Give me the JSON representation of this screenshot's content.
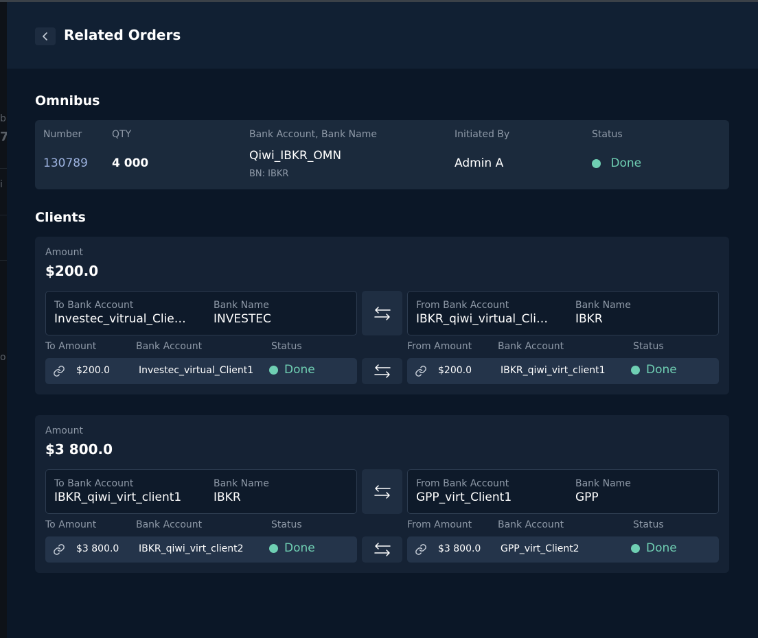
{
  "header": {
    "title": "Related Orders"
  },
  "backdrop": {
    "frag1": "b",
    "frag2": "7",
    "frag3": "i",
    "frag4": "o"
  },
  "omnibus": {
    "title": "Omnibus",
    "headers": {
      "number": "Number",
      "qty": "QTY",
      "bank": "Bank Account, Bank Name",
      "initiated": "Initiated By",
      "status": "Status"
    },
    "number": "130789",
    "qty": "4 000",
    "bank_account": "Qiwi_IBKR_OMN",
    "bank_name": "BN: IBKR",
    "initiated_by": "Admin A",
    "status": "Done"
  },
  "clients": {
    "title": "Clients",
    "labels": {
      "amount": "Amount",
      "to_bank_account": "To Bank Account",
      "bank_name": "Bank Name",
      "from_bank_account": "From Bank Account",
      "to_amount": "To Amount",
      "from_amount": "From Amount",
      "bank_account": "Bank Account",
      "status": "Status"
    },
    "items": [
      {
        "amount": "$200.0",
        "to_account": "Investec_vitrual_Clie…",
        "to_bank": "INVESTEC",
        "from_account": "IBKR_qiwi_virtual_Cli…",
        "from_bank": "IBKR",
        "to_row": {
          "amount": "$200.0",
          "account": "Investec_virtual_Client1",
          "status": "Done"
        },
        "from_row": {
          "amount": "$200.0",
          "account": "IBKR_qiwi_virt_client1",
          "status": "Done"
        }
      },
      {
        "amount": "$3 800.0",
        "to_account": "IBKR_qiwi_virt_client1",
        "to_bank": "IBKR",
        "from_account": "GPP_virt_Client1",
        "from_bank": "GPP",
        "to_row": {
          "amount": "$3 800.0",
          "account": "IBKR_qiwi_virt_client2",
          "status": "Done"
        },
        "from_row": {
          "amount": "$3 800.0",
          "account": "GPP_virt_Client2",
          "status": "Done"
        }
      }
    ]
  },
  "colors": {
    "accent_done": "#6fcfb3",
    "link_number": "#9db3e0",
    "panel": "#0b1727"
  },
  "icons": {
    "back": "chevron-left-icon",
    "swap": "swap-arrows-icon",
    "link": "link-icon",
    "status": "status-dot-icon"
  }
}
